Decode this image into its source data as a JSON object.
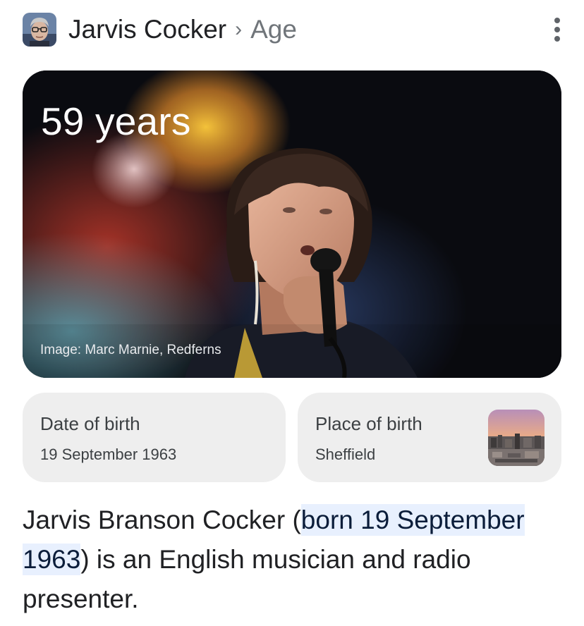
{
  "header": {
    "entity_name": "Jarvis Cocker",
    "separator": "›",
    "attribute": "Age",
    "avatar_icon": "person-avatar-icon",
    "menu_icon": "more-vert-icon"
  },
  "hero": {
    "age_text": "59 years",
    "credit": "Image: Marc Marnie, Redferns"
  },
  "cards": {
    "date_of_birth": {
      "label": "Date of birth",
      "value": "19 September 1963"
    },
    "place_of_birth": {
      "label": "Place of birth",
      "value": "Sheffield",
      "thumb_icon": "city-thumbnail"
    }
  },
  "description": {
    "before": "Jarvis Branson Cocker (",
    "highlight": "born 19 September 1963",
    "after": ") is an English musician and radio presenter."
  },
  "colors": {
    "highlight_bg": "#e8f0fe",
    "card_bg": "#eeeeee",
    "muted_text": "#70757a"
  }
}
